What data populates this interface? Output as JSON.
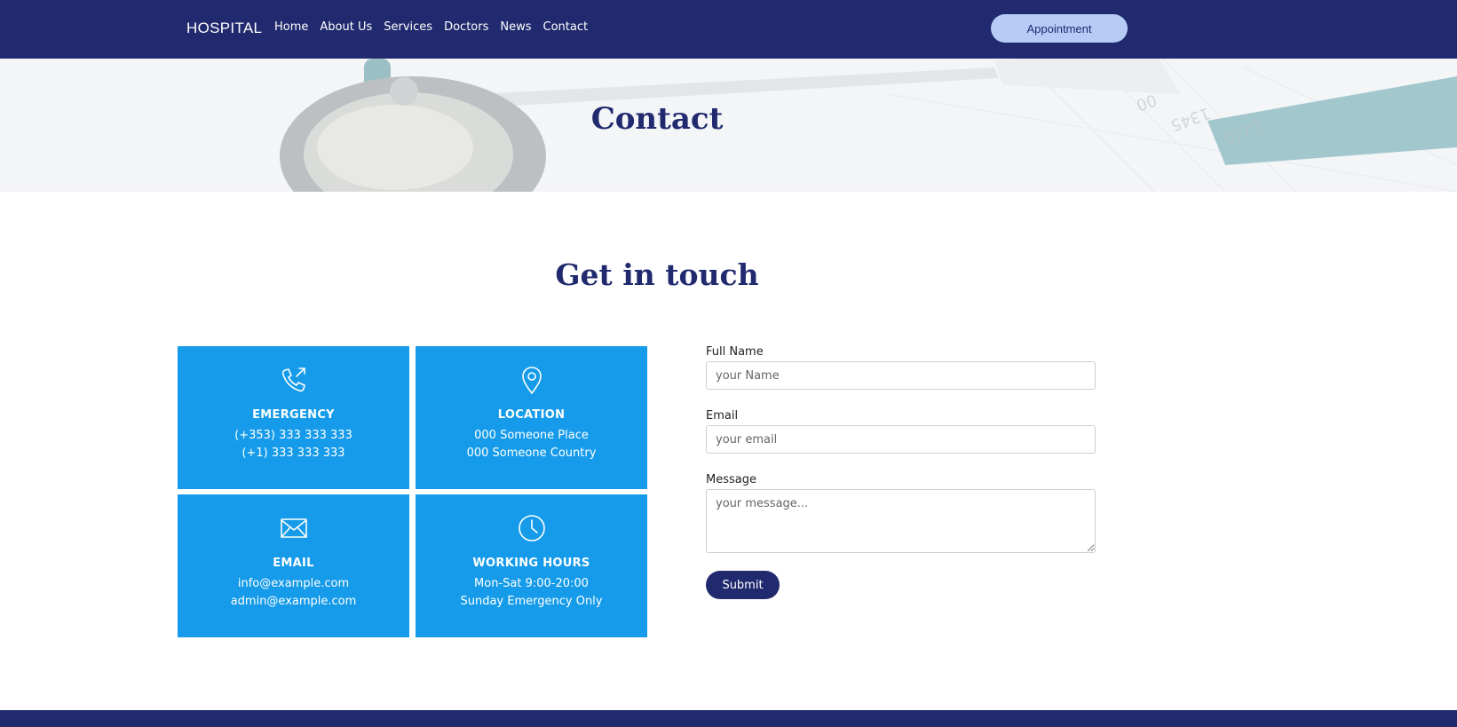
{
  "nav": {
    "brand": "HOSPITAL",
    "links": [
      "Home",
      "About Us",
      "Services",
      "Doctors",
      "News",
      "Contact"
    ],
    "appointment_label": "Appointment"
  },
  "hero": {
    "title": "Contact"
  },
  "section": {
    "title": "Get in touch"
  },
  "cards": [
    {
      "icon": "phone-icon",
      "label": "EMERGENCY",
      "lines": [
        "(+353) 333 333 333",
        "(+1) 333 333 333"
      ]
    },
    {
      "icon": "location-pin-icon",
      "label": "LOCATION",
      "lines": [
        "000 Someone Place",
        "000 Someone Country"
      ]
    },
    {
      "icon": "envelope-icon",
      "label": "EMAIL",
      "lines": [
        "info@example.com",
        "admin@example.com"
      ]
    },
    {
      "icon": "clock-icon",
      "label": "WORKING HOURS",
      "lines": [
        "Mon-Sat 9:00-20:00",
        "Sunday Emergency Only"
      ]
    }
  ],
  "form": {
    "name_label": "Full Name",
    "name_placeholder": "your Name",
    "email_label": "Email",
    "email_placeholder": "your email",
    "message_label": "Message",
    "message_placeholder": "your message...",
    "submit_label": "Submit"
  },
  "colors": {
    "navy": "#212a6e",
    "card_blue": "#159be9",
    "appointment_bg": "#b6cbf6"
  }
}
